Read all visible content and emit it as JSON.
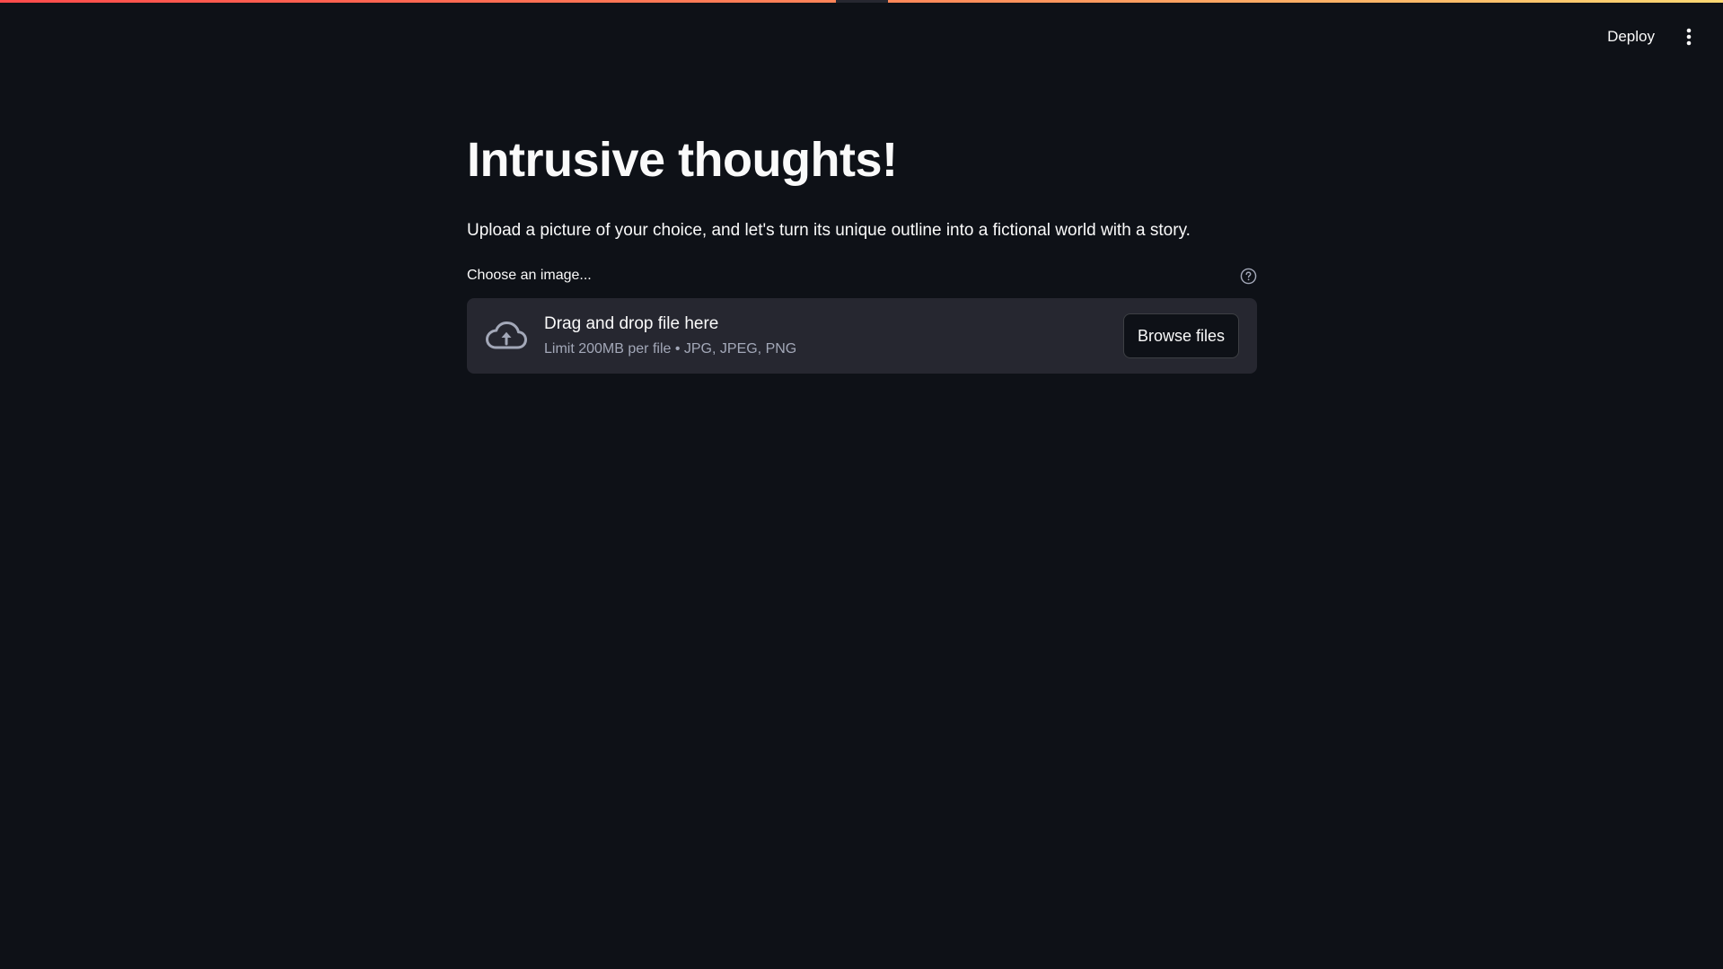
{
  "header": {
    "deploy_label": "Deploy",
    "menu_icon": "vertical-dots-icon",
    "accent_gradient": [
      "#ff4b4b",
      "#ff8c5a",
      "#fdd873"
    ]
  },
  "main": {
    "title": "Intrusive thoughts!",
    "subtitle": "Upload a picture of your choice, and let's turn its unique outline into a fictional world with a story."
  },
  "uploader": {
    "label": "Choose an image...",
    "help_icon": "question-circle-icon",
    "upload_icon": "cloud-upload-icon",
    "dropzone_title": "Drag and drop file here",
    "dropzone_hint": "Limit 200MB per file • JPG, JPEG, PNG",
    "browse_label": "Browse files"
  },
  "colors": {
    "background": "#0e1117",
    "surface": "#262730",
    "text": "#fafafa",
    "muted_text": "#a3a8b8"
  }
}
